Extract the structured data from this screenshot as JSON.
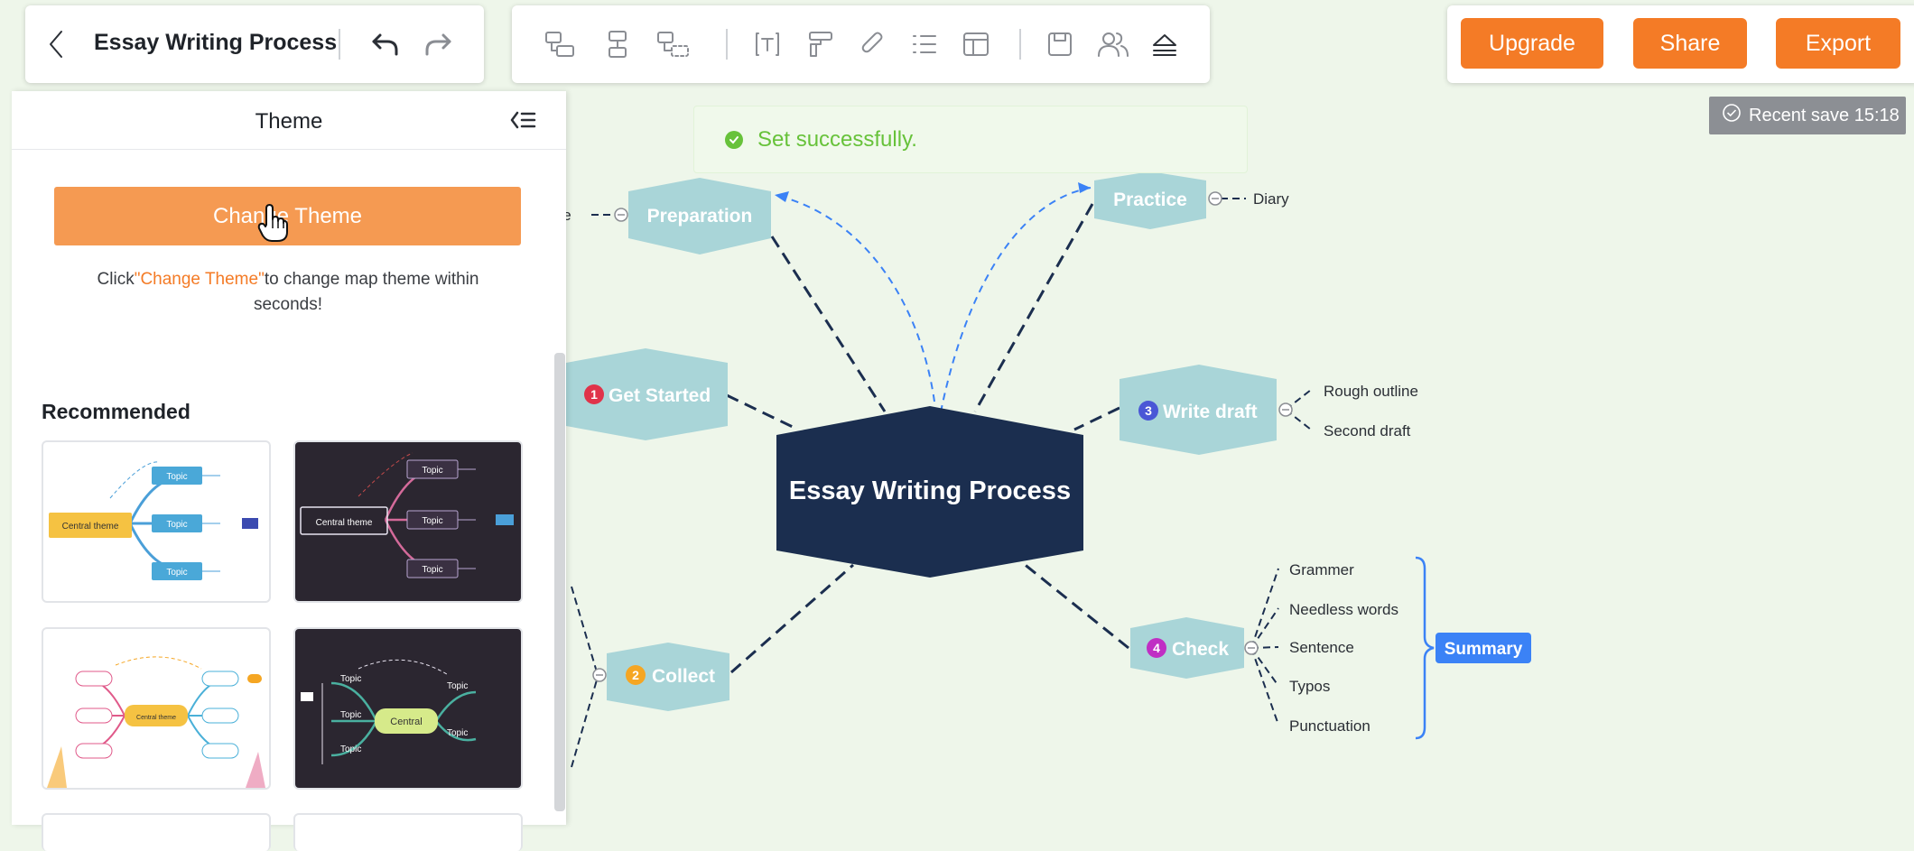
{
  "toolbar_left": {
    "title": "Essay Writing Process"
  },
  "actions": {
    "upgrade": "Upgrade",
    "share": "Share",
    "export": "Export"
  },
  "save_status": "Recent save 15:18",
  "toast": "Set successfully.",
  "panel": {
    "title": "Theme",
    "change_theme_button": "Change Theme",
    "hint_prefix": "Click",
    "hint_link": "\"Change Theme\"",
    "hint_suffix": "to change map theme within seconds!",
    "recommended": "Recommended",
    "thumbnails": [
      {
        "central": "Central theme",
        "topic": "Topic"
      },
      {
        "central": "Central theme",
        "topic": "Topic"
      },
      {
        "central": "Central theme",
        "topic": "Topic"
      },
      {
        "central": "Central",
        "topic": "Topic"
      }
    ]
  },
  "mindmap": {
    "central": "Essay Writing Process",
    "branches": {
      "preparation": {
        "label": "Preparation",
        "leaf": "ige"
      },
      "practice": {
        "label": "Practice",
        "leaf": "Diary"
      },
      "get_started": {
        "label": "Get Started",
        "num": "1"
      },
      "write_draft": {
        "label": "Write draft",
        "num": "3",
        "leaves": [
          "Rough outline",
          "Second draft"
        ]
      },
      "collect": {
        "label": "Collect",
        "num": "2"
      },
      "check": {
        "label": "Check",
        "num": "4",
        "leaves": [
          "Grammer",
          "Needless words",
          "Sentence",
          "Typos",
          "Punctuation"
        ]
      }
    },
    "summary": "Summary"
  },
  "colors": {
    "accent": "#f47b26",
    "central_node": "#1b2e4f",
    "branch_node": "#a9d5d8",
    "summary": "#3b82f6",
    "background": "#eef6ea"
  }
}
